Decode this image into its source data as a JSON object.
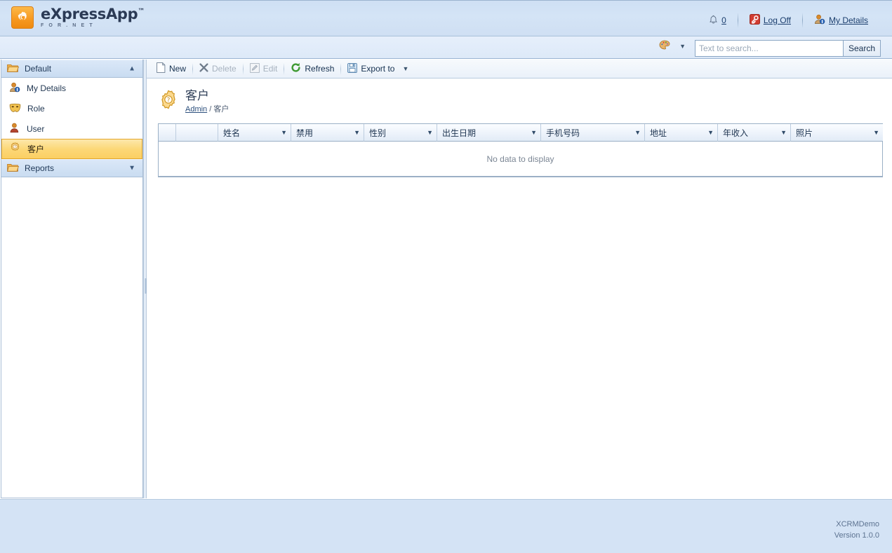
{
  "header": {
    "brand": "eXpressApp",
    "brand_tm": "™",
    "brand_sub": "F O R  . N E T",
    "logo_icon": "gear-logo-icon",
    "links": [
      {
        "icon": "bell-icon",
        "label": "0",
        "name": "notifications-link"
      },
      {
        "icon": "key-icon",
        "label": "Log Off",
        "name": "log-off-link"
      },
      {
        "icon": "user-details-icon",
        "label": "My Details",
        "name": "my-details-link"
      }
    ]
  },
  "subbar": {
    "palette_icon": "palette-icon",
    "palette_caret": "▼",
    "search": {
      "placeholder": "Text to search...",
      "value": "",
      "button_label": "Search"
    }
  },
  "sidebar": {
    "groups": [
      {
        "label": "Default",
        "icon": "folder-open-icon",
        "chevron": "▲",
        "expanded": true,
        "items": [
          {
            "label": "My Details",
            "icon": "user-details-icon",
            "selected": false
          },
          {
            "label": "Role",
            "icon": "mask-icon",
            "selected": false
          },
          {
            "label": "User",
            "icon": "user-icon",
            "selected": false
          },
          {
            "label": "客户",
            "icon": "gear-question-icon",
            "selected": true
          }
        ]
      },
      {
        "label": "Reports",
        "icon": "folder-open-icon",
        "chevron": "▼",
        "expanded": false,
        "items": []
      }
    ]
  },
  "toolbar": {
    "buttons": [
      {
        "label": "New",
        "icon": "new-page-icon",
        "disabled": false
      },
      {
        "label": "Delete",
        "icon": "x-icon",
        "disabled": true
      },
      {
        "label": "Edit",
        "icon": "edit-pencil-icon",
        "disabled": true
      },
      {
        "label": "Refresh",
        "icon": "refresh-icon",
        "disabled": false
      },
      {
        "label": "Export to",
        "icon": "export-disk-icon",
        "disabled": false,
        "caret": "▼"
      }
    ]
  },
  "page": {
    "icon": "gear-question-icon",
    "title": "客户",
    "breadcrumb_root": "Admin",
    "breadcrumb_sep": " / ",
    "breadcrumb_current": "客户"
  },
  "grid": {
    "columns": [
      {
        "label": "",
        "width": 25,
        "filter": false
      },
      {
        "label": "",
        "width": 60,
        "filter": false
      },
      {
        "label": "姓名",
        "width": 104,
        "filter": true
      },
      {
        "label": "禁用",
        "width": 104,
        "filter": true
      },
      {
        "label": "性别",
        "width": 104,
        "filter": true
      },
      {
        "label": "出生日期",
        "width": 148,
        "filter": true
      },
      {
        "label": "手机号码",
        "width": 148,
        "filter": true
      },
      {
        "label": "地址",
        "width": 104,
        "filter": true
      },
      {
        "label": "年收入",
        "width": 104,
        "filter": true
      },
      {
        "label": "照片",
        "width": 131,
        "filter": true
      }
    ],
    "filter_glyph": "▼",
    "rows": [],
    "empty_text": "No data to display"
  },
  "footer": {
    "app_name": "XCRMDemo",
    "version": "Version 1.0.0"
  },
  "colors": {
    "header_blue": "#d4e4f6",
    "accent_orange": "#f79a22",
    "selected_gold": "#fcd878",
    "link_blue": "#1c3f6e",
    "footer_blue": "#d4e3f5"
  }
}
